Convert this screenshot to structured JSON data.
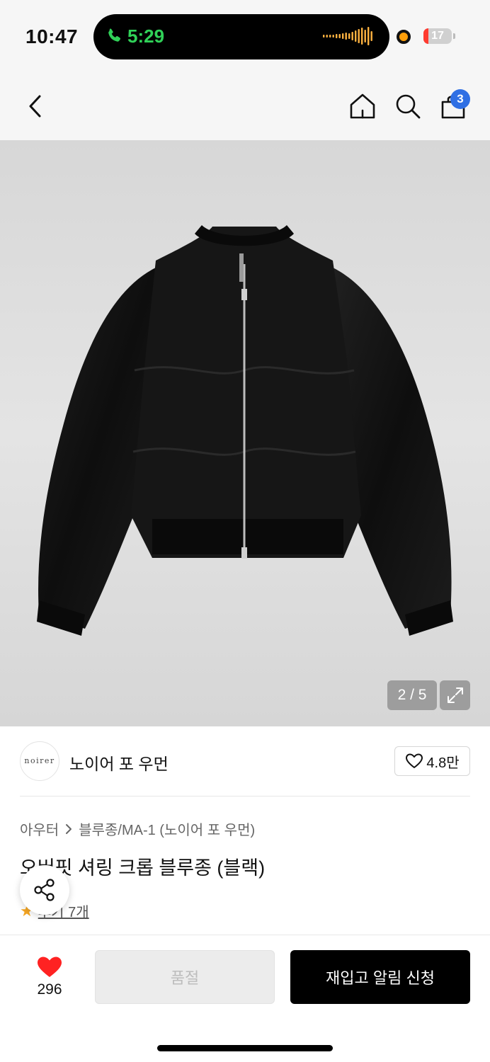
{
  "status_bar": {
    "time": "10:47",
    "call_time": "5:29",
    "battery_level": "17",
    "call_color": "#30d158",
    "recording_dot_color": "#ff9f0a",
    "battery_fill_color": "#ff3b30",
    "battery_fill_percent": 17
  },
  "nav": {
    "back_icon": "chevron-left-icon",
    "home_icon": "home-icon",
    "search_icon": "search-icon",
    "cart_icon": "shopping-bag-icon",
    "cart_badge": "3",
    "cart_badge_color": "#2f6fe4"
  },
  "gallery": {
    "counter": "2 / 5",
    "expand_icon": "expand-icon"
  },
  "brand": {
    "logo_text": "noirer",
    "name": "노이어 포 우먼",
    "likes": "4.8만"
  },
  "product": {
    "breadcrumb": [
      "아우터",
      "블루종/MA-1 (노이어 포 우먼)"
    ],
    "title": "오버핏 셔링 크롭 블루종 (블랙)",
    "rating_icon": "star-icon",
    "reviews": "후기 7개"
  },
  "share": {
    "icon": "share-icon"
  },
  "bottom": {
    "wish_count": "296",
    "wish_color": "#ff2222",
    "soldout_label": "품절",
    "restock_label": "재입고 알림 신청"
  }
}
